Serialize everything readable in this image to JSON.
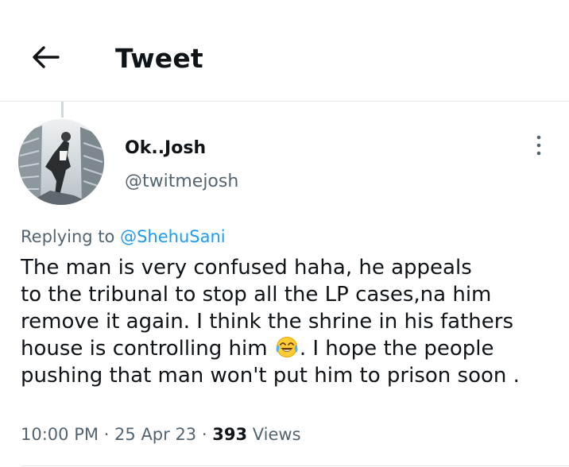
{
  "header": {
    "back_icon": "arrow-left-icon",
    "title": "Tweet"
  },
  "author": {
    "display_name": "Ok..Josh",
    "handle": "@twitmejosh",
    "more_icon": "more-vertical-icon"
  },
  "reply": {
    "prefix": "Replying to",
    "mention": "@ShehuSani"
  },
  "tweet": {
    "lines": [
      "The man is very confused haha, he appeals",
      "to the tribunal to stop all the LP cases,na him",
      "remove it again. I think the shrine in his fathers",
      "house is controlling him",
      ". I hope the people",
      "pushing that man won't put him to prison soon ."
    ],
    "emoji_icon": "face-with-tears-of-joy-icon"
  },
  "meta": {
    "time": "10:00 PM",
    "separator": "·",
    "date": "25 Apr 23",
    "views_count": "393",
    "views_label": "Views"
  },
  "colors": {
    "accent": "#1d9bf0",
    "text_primary": "#0f1419",
    "text_secondary": "#536471",
    "divider": "#e6e9ec"
  }
}
